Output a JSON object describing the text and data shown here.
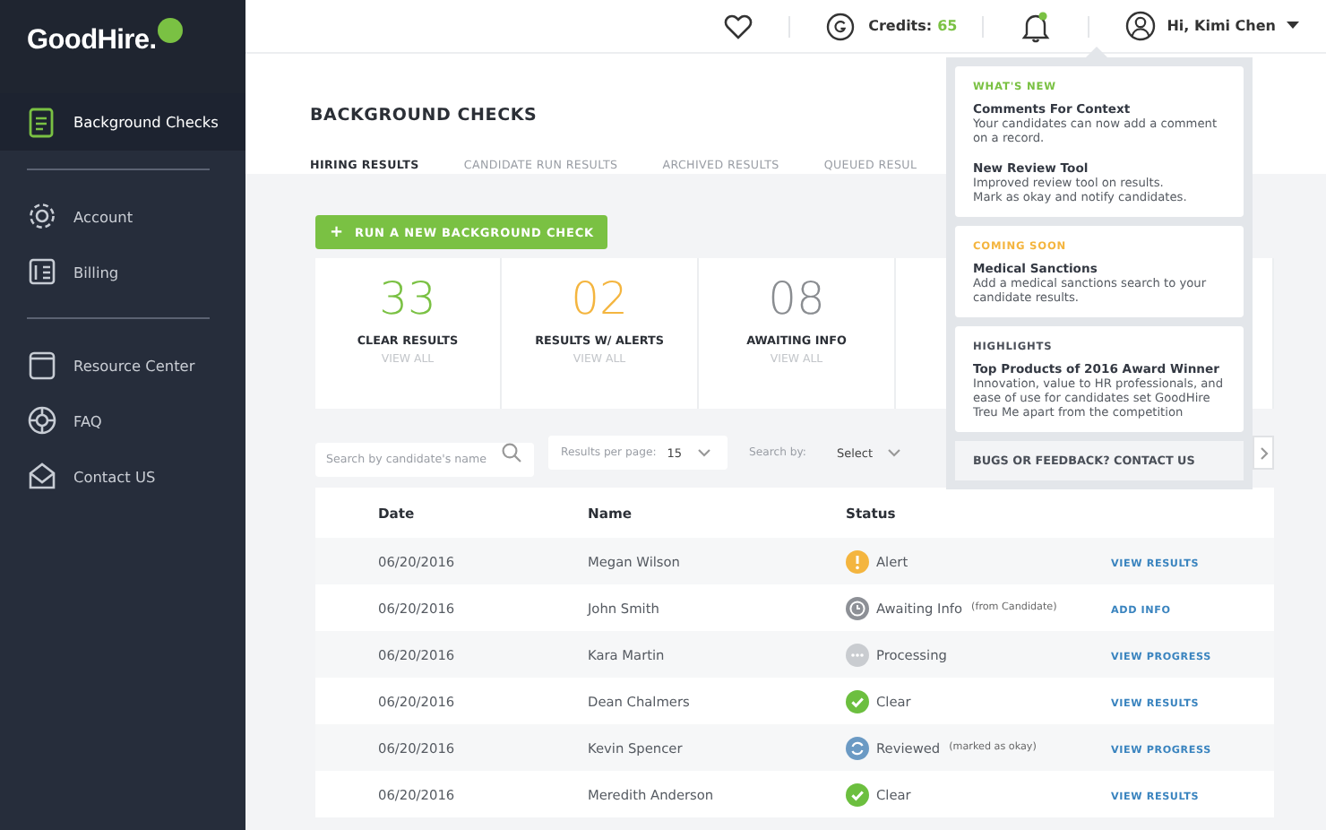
{
  "brand": {
    "name": "GoodHire."
  },
  "sidebar": {
    "groups": [
      {
        "items": [
          {
            "label": "Background Checks",
            "selected": true
          }
        ]
      },
      {
        "items": [
          {
            "label": "Account",
            "selected": false
          },
          {
            "label": "Billing",
            "selected": false
          }
        ]
      },
      {
        "items": [
          {
            "label": "Resource Center",
            "selected": false
          },
          {
            "label": "FAQ",
            "selected": false
          },
          {
            "label": "Contact US",
            "selected": false
          }
        ]
      }
    ]
  },
  "header": {
    "credits_label": "Credits:",
    "credits_value": "65",
    "greeting": "Hi, Kimi Chen"
  },
  "page_title": "BACKGROUND CHECKS",
  "tabs": [
    {
      "label": "HIRING RESULTS",
      "selected": true
    },
    {
      "label": "CANDIDATE RUN RESULTS",
      "selected": false
    },
    {
      "label": "ARCHIVED RESULTS",
      "selected": false
    },
    {
      "label": "QUEUED RESUL",
      "selected": false
    }
  ],
  "run_button": {
    "label": "RUN A NEW BACKGROUND CHECK",
    "icon": "+"
  },
  "stats": [
    {
      "value": "33",
      "label": "CLEAR RESULTS",
      "link": "VIEW ALL",
      "color": "#7ac143"
    },
    {
      "value": "02",
      "label": "RESULTS W/ ALERTS",
      "link": "VIEW ALL",
      "color": "#f4b53f"
    },
    {
      "value": "08",
      "label": "AWAITING INFO",
      "link": "VIEW ALL",
      "color": "#8a8d91"
    }
  ],
  "filters": {
    "search_placeholder": "Search by candidate's name",
    "per_page_label": "Results per page:",
    "per_page_value": "15",
    "search_by_label": "Search by:",
    "search_by_value": "Select"
  },
  "table": {
    "columns": [
      "Date",
      "Name",
      "Status"
    ],
    "rows": [
      {
        "date": "06/20/2016",
        "name": "Megan Wilson",
        "status": "Alert",
        "kind": "alert",
        "action": "VIEW RESULTS"
      },
      {
        "date": "06/20/2016",
        "name": "John Smith",
        "status": "Awaiting Info",
        "note": "(from Candidate)",
        "kind": "awaiting",
        "action": "ADD INFO"
      },
      {
        "date": "06/20/2016",
        "name": "Kara Martin",
        "status": "Processing",
        "kind": "processing",
        "action": "VIEW PROGRESS"
      },
      {
        "date": "06/20/2016",
        "name": "Dean Chalmers",
        "status": "Clear",
        "kind": "clear",
        "action": "VIEW RESULTS"
      },
      {
        "date": "06/20/2016",
        "name": "Kevin Spencer",
        "status": "Reviewed",
        "note": "(marked as okay)",
        "kind": "reviewed",
        "action": "VIEW PROGRESS"
      },
      {
        "date": "06/20/2016",
        "name": "Meredith Anderson",
        "status": "Clear",
        "kind": "clear",
        "action": "VIEW RESULTS"
      }
    ]
  },
  "notifications": {
    "sections": [
      {
        "heading": "WHAT'S NEW",
        "color": "#7ac143",
        "items": [
          {
            "title": "Comments For Context",
            "text": "Your candidates can now add a comment on a record."
          },
          {
            "title": "New Review Tool",
            "text": "Improved review tool on results.\nMark as okay and notify candidates."
          }
        ]
      },
      {
        "heading": "COMING SOON",
        "color": "#f4b53f",
        "items": [
          {
            "title": "Medical Sanctions",
            "text": "Add a medical sanctions search to your candidate results."
          }
        ]
      },
      {
        "heading": "HIGHLIGHTS",
        "color": "#4a4f58",
        "items": [
          {
            "title": "Top Products of 2016 Award Winner",
            "text": "Innovation, value to HR professionals, and ease of use for candidates set GoodHire Treu Me apart from the competition"
          }
        ]
      }
    ],
    "footer": "BUGS OR FEEDBACK? CONTACT US"
  }
}
